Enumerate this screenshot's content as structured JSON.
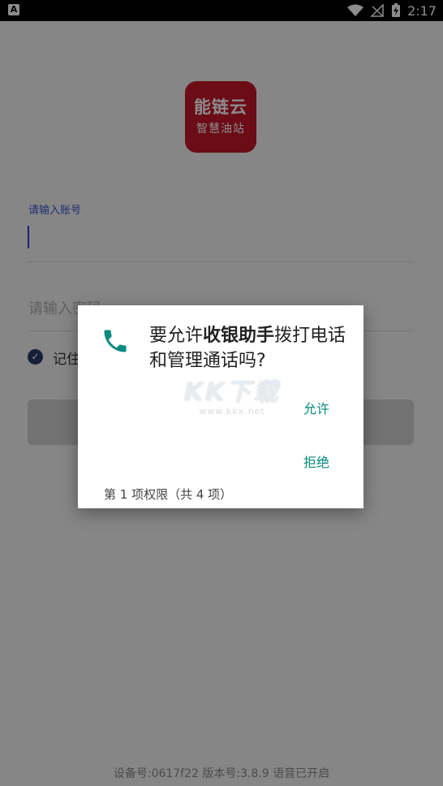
{
  "status_bar": {
    "left_icon": "A",
    "time": "2:17",
    "icons": [
      "wifi-icon",
      "no-signal-icon",
      "battery-charging-icon"
    ]
  },
  "logo": {
    "line1": "能链云",
    "line2": "智慧油站",
    "color": "#c4162b"
  },
  "form": {
    "account_label": "请输入账号",
    "password_placeholder": "请输入密码",
    "remember_label": "记住",
    "accent": "#2b3a67"
  },
  "footer": {
    "text": "设备号:0617f22 版本号:3.8.9 语音已开启"
  },
  "dialog": {
    "title_prefix": "要允许",
    "title_app": "收银助手",
    "title_suffix": "拨打电话和管理通话吗?",
    "allow_label": "允许",
    "deny_label": "拒绝",
    "counter": "第 1 项权限（共 4 项）",
    "button_color": "#0a8a80"
  },
  "watermark": {
    "big": "KK下载",
    "small": "www.kkx.net"
  }
}
